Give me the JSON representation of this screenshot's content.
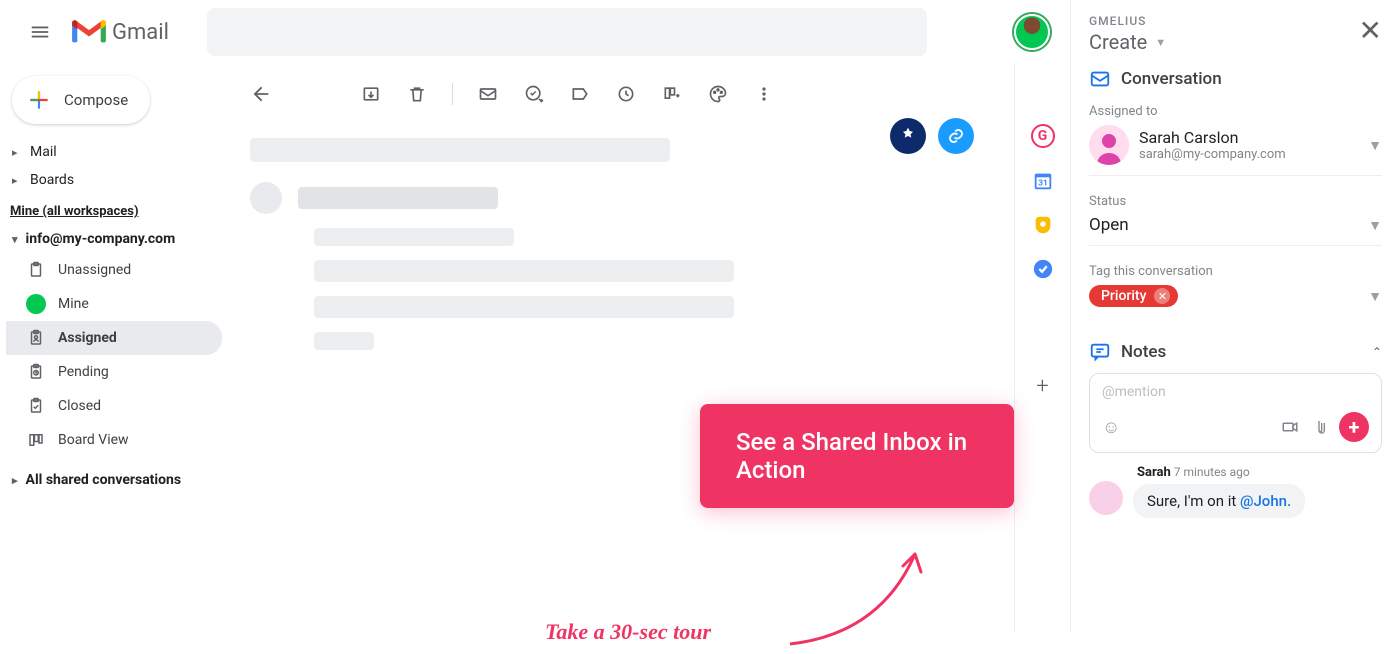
{
  "header": {
    "app_name": "Gmail",
    "search_placeholder": ""
  },
  "sidebar": {
    "compose_label": "Compose",
    "nav": {
      "mail": "Mail",
      "boards": "Boards"
    },
    "section_mine": "Mine (all workspaces)",
    "workspace": "info@my-company.com",
    "items": {
      "unassigned": "Unassigned",
      "mine": "Mine",
      "assigned": "Assigned",
      "pending": "Pending",
      "closed": "Closed",
      "board": "Board View"
    },
    "all_shared": "All shared conversations"
  },
  "cta": {
    "button": "See a Shared Inbox in Action",
    "tour": "Take a 30-sec tour"
  },
  "panel": {
    "brand": "GMELIUS",
    "create": "Create",
    "section_conversation": "Conversation",
    "assigned_to_label": "Assigned to",
    "assignee_name": "Sarah Carslon",
    "assignee_email": "sarah@my-company.com",
    "status_label": "Status",
    "status_value": "Open",
    "tag_label": "Tag this conversation",
    "tag_value": "Priority",
    "notes_title": "Notes",
    "notes_placeholder": "@mention",
    "note_author": "Sarah",
    "note_time": "7 minutes ago",
    "note_text": "Sure, I'm on it ",
    "note_mention": "@John."
  }
}
